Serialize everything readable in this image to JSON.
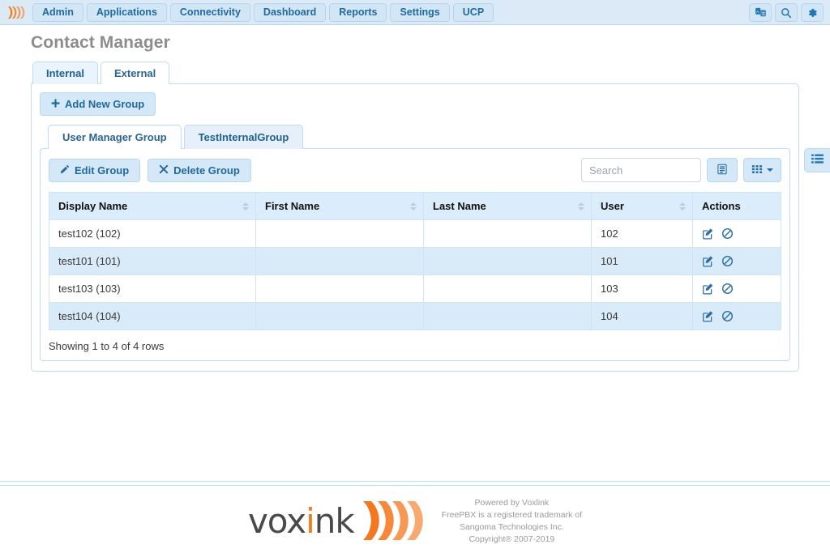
{
  "navbar": {
    "brand_icon": "voxlink-wave-logo",
    "items": [
      {
        "label": "Admin",
        "icon": "nav-admin"
      },
      {
        "label": "Applications",
        "icon": "nav-applications"
      },
      {
        "label": "Connectivity",
        "icon": "nav-connectivity"
      },
      {
        "label": "Dashboard",
        "icon": "nav-dashboard"
      },
      {
        "label": "Reports",
        "icon": "nav-reports"
      },
      {
        "label": "Settings",
        "icon": "nav-settings"
      },
      {
        "label": "UCP",
        "icon": "nav-ucp"
      }
    ],
    "right_icons": [
      {
        "name": "language-translate-icon",
        "title": "Language"
      },
      {
        "name": "search-icon",
        "title": "Search"
      },
      {
        "name": "gear-icon",
        "title": "Settings"
      }
    ]
  },
  "page": {
    "title": "Contact Manager"
  },
  "tabs": [
    {
      "label": "Internal",
      "active": true
    },
    {
      "label": "External",
      "active": false
    }
  ],
  "panel": {
    "add_group_label": "Add New Group",
    "add_group_icon": "plus-icon"
  },
  "group_tabs": [
    {
      "label": "User Manager Group",
      "active": false
    },
    {
      "label": "TestInternalGroup",
      "active": true
    }
  ],
  "toolbar": {
    "edit_group_label": "Edit Group",
    "edit_group_icon": "pencil-icon",
    "delete_group_label": "Delete Group",
    "delete_group_icon": "times-icon",
    "search_placeholder": "Search",
    "search_value": "",
    "detail_view_icon": "detail-view-icon",
    "columns_icon": "columns-grid-icon"
  },
  "table": {
    "columns": [
      {
        "label": "Display Name",
        "sortable": true
      },
      {
        "label": "First Name",
        "sortable": true
      },
      {
        "label": "Last Name",
        "sortable": true
      },
      {
        "label": "User",
        "sortable": true
      },
      {
        "label": "Actions",
        "sortable": false
      }
    ],
    "rows": [
      {
        "display_name": "test102 (102)",
        "first_name": "",
        "last_name": "",
        "user": "102"
      },
      {
        "display_name": "test101 (101)",
        "first_name": "",
        "last_name": "",
        "user": "101"
      },
      {
        "display_name": "test103 (103)",
        "first_name": "",
        "last_name": "",
        "user": "103"
      },
      {
        "display_name": "test104 (104)",
        "first_name": "",
        "last_name": "",
        "user": "104"
      }
    ],
    "row_actions": [
      {
        "name": "edit-contact-icon"
      },
      {
        "name": "disable-contact-icon"
      }
    ],
    "showing_text": "Showing 1 to 4 of 4 rows"
  },
  "side_tab": {
    "icon": "th-list-icon"
  },
  "footer": {
    "logo_text_left": "vox",
    "logo_text_i": "i",
    "logo_text_right": "nk",
    "logo_wave_icon": "voxlink-wave-logo",
    "lines": [
      "Powered by Voxlink",
      "FreePBX is a registered trademark of",
      "Sangoma Technologies Inc.",
      "Copyright® 2007-2019"
    ]
  },
  "colors": {
    "navbar_bg": "#dceaf7",
    "accent_blue": "#2a6496",
    "brand_orange": "#f07d1a",
    "panel_border": "#bcdcf2",
    "row_alt": "#d9eaf8",
    "header_bg": "#dbecfa"
  }
}
